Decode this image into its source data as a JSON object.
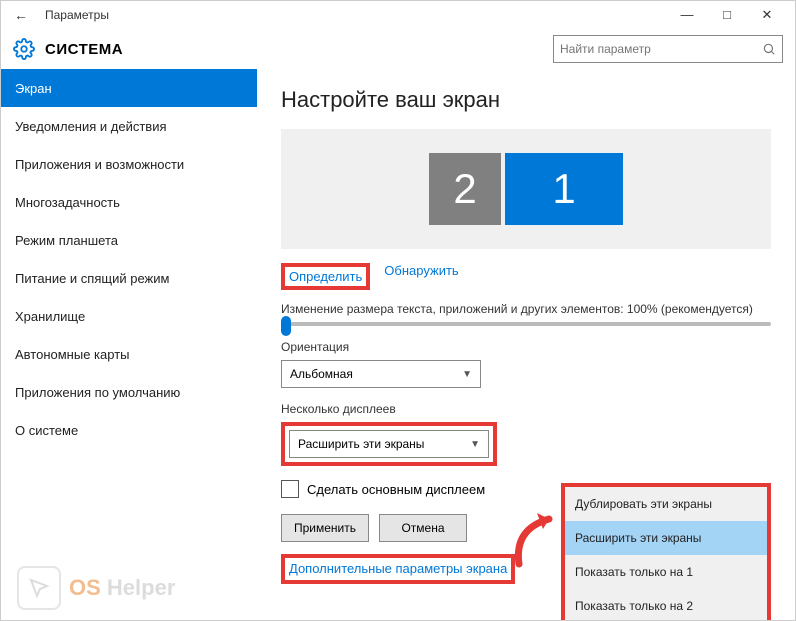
{
  "titlebar": {
    "title": "Параметры"
  },
  "header": {
    "section": "СИСТЕМА",
    "search_placeholder": "Найти параметр"
  },
  "sidebar": {
    "items": [
      {
        "label": "Экран",
        "selected": true
      },
      {
        "label": "Уведомления и действия"
      },
      {
        "label": "Приложения и возможности"
      },
      {
        "label": "Многозадачность"
      },
      {
        "label": "Режим планшета"
      },
      {
        "label": "Питание и спящий режим"
      },
      {
        "label": "Хранилище"
      },
      {
        "label": "Автономные карты"
      },
      {
        "label": "Приложения по умолчанию"
      },
      {
        "label": "О системе"
      }
    ]
  },
  "main": {
    "heading": "Настройте ваш экран",
    "monitors": {
      "m2": "2",
      "m1": "1"
    },
    "identify": "Определить",
    "detect": "Обнаружить",
    "scale_label": "Изменение размера текста, приложений и других элементов: 100% (рекомендуется)",
    "orientation_label": "Ориентация",
    "orientation_value": "Альбомная",
    "multi_label": "Несколько дисплеев",
    "multi_value": "Расширить эти экраны",
    "make_main": "Сделать основным дисплеем",
    "apply": "Применить",
    "cancel": "Отмена",
    "advanced": "Дополнительные параметры экрана",
    "dropdown": {
      "opt0": "Дублировать эти экраны",
      "opt1": "Расширить эти экраны",
      "opt2": "Показать только на 1",
      "opt3": "Показать только на 2"
    }
  },
  "watermark": {
    "os": "OS",
    "helper": "Helper"
  }
}
